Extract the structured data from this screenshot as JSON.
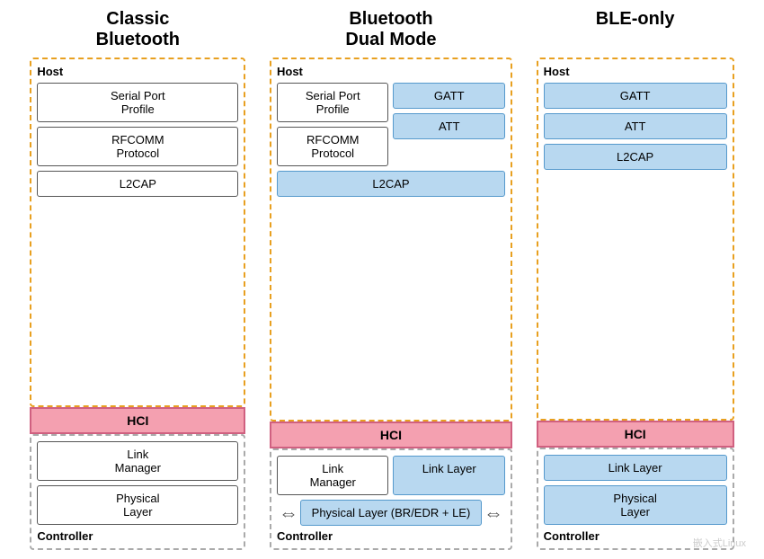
{
  "columns": {
    "classic": {
      "title": "Classic\nBluetooth",
      "host_label": "Host",
      "hci": "HCI",
      "controller_label": "Controller",
      "host_blocks": [
        {
          "label": "Serial Port\nProfile",
          "type": "white"
        },
        {
          "label": "RFCOMM\nProtocol",
          "type": "white"
        },
        {
          "label": "L2CAP",
          "type": "white"
        }
      ],
      "controller_blocks": [
        {
          "label": "Link\nManager",
          "type": "white"
        },
        {
          "label": "Physical\nLayer",
          "type": "white"
        }
      ]
    },
    "dual": {
      "title": "Bluetooth\nDual Mode",
      "host_label": "Host",
      "hci": "HCI",
      "controller_label": "Controller",
      "host_left": [
        {
          "label": "Serial Port\nProfile",
          "type": "white"
        },
        {
          "label": "RFCOMM\nProtocol",
          "type": "white"
        }
      ],
      "host_right": [
        {
          "label": "GATT",
          "type": "blue"
        },
        {
          "label": "ATT",
          "type": "blue"
        }
      ],
      "host_bottom": {
        "label": "L2CAP",
        "type": "blue"
      },
      "controller_left": {
        "label": "Link\nManager",
        "type": "white"
      },
      "controller_right": {
        "label": "Link Layer",
        "type": "blue"
      },
      "controller_bottom": {
        "label": "Physical Layer (BR/EDR + LE)",
        "type": "blue"
      }
    },
    "ble": {
      "title": "BLE-only",
      "host_label": "Host",
      "hci": "HCI",
      "controller_label": "Controller",
      "host_blocks": [
        {
          "label": "GATT",
          "type": "blue"
        },
        {
          "label": "ATT",
          "type": "blue"
        },
        {
          "label": "L2CAP",
          "type": "blue"
        }
      ],
      "controller_blocks": [
        {
          "label": "Link Layer",
          "type": "blue"
        },
        {
          "label": "Physical\nLayer",
          "type": "blue"
        }
      ]
    }
  },
  "arrows": {
    "left": "⇔",
    "right": "⇔"
  },
  "watermark": "嵌入式Linux"
}
